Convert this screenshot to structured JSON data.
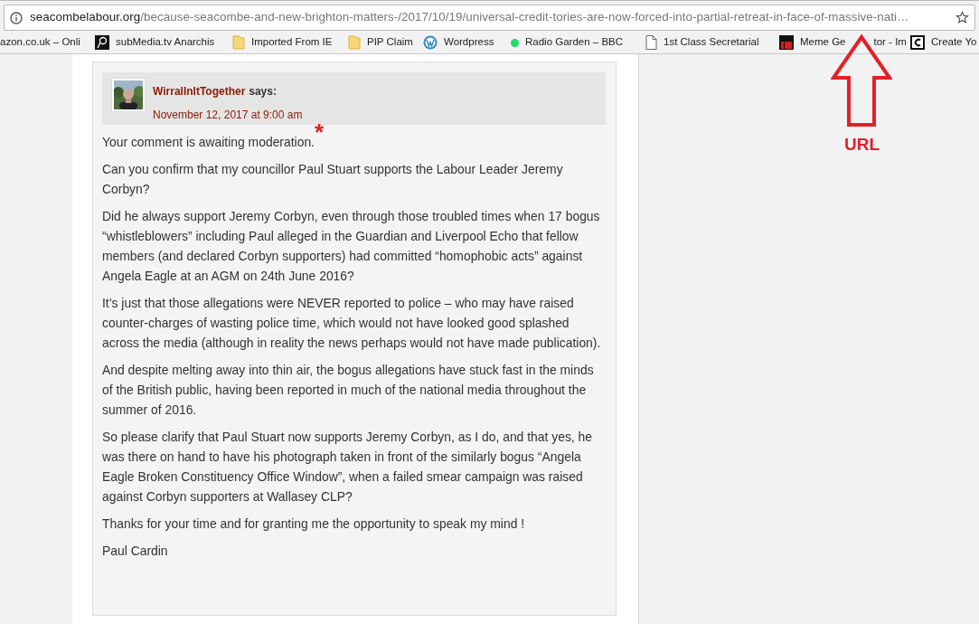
{
  "browser": {
    "url": {
      "domain": "seacombelabour.org",
      "path": "/because-seacombe-and-new-brighton-matters-/2017/10/19/universal-credit-tories-are-now-forced-into-partial-retreat-in-face-of-massive-nati…"
    },
    "bookmarks": [
      {
        "label": "azon.co.uk – Onli",
        "kind": "none"
      },
      {
        "label": "subMedia.tv Anarchis",
        "kind": "dark-square"
      },
      {
        "label": "Imported From IE",
        "kind": "folder"
      },
      {
        "label": "PIP Claim",
        "kind": "folder"
      },
      {
        "label": "Wordpress",
        "kind": "wordpress"
      },
      {
        "label": "Radio Garden – BBC",
        "kind": "dot",
        "color": "#22dd66"
      },
      {
        "label": "1st Class Secretarial",
        "kind": "page"
      },
      {
        "label": "Meme Ge",
        "label_tail": "tor - Im",
        "kind": "red-square"
      },
      {
        "label": "Create Yo",
        "kind": "outlined-square"
      }
    ]
  },
  "comment": {
    "author": "WirralInItTogether",
    "says": "says:",
    "date": "November 12, 2017 at 9:00 am",
    "moderation": "Your comment is awaiting moderation.",
    "paragraphs": [
      "Can you confirm that my councillor Paul Stuart supports the Labour Leader Jeremy Corbyn?",
      "Did he always support Jeremy Corbyn, even through those troubled times when 17 bogus “whistleblowers” including Paul alleged in the Guardian and Liverpool Echo that fellow members (and declared Corbyn supporters) had committed “homophobic acts” against Angela Eagle at an AGM on 24th June 2016?",
      "It’s just that those allegations were NEVER reported to police – who may have raised counter-charges of wasting police time, which would not have looked good splashed across the media (although in reality the news perhaps would not have made publication).",
      "And despite melting away into thin air, the bogus allegations have stuck fast in the minds of the British public, having been reported in much of the national media throughout the summer of 2016.",
      "So please clarify that Paul Stuart now supports Jeremy Corbyn, as I do, and that yes, he was there on hand to have his photograph taken in front of the similarly bogus “Angela Eagle Broken Constituency Office Window”, when a failed smear campaign was raised against Corbyn supporters at Wallasey CLP?",
      "Thanks for your time and for granting me the opportunity to speak my mind !",
      "Paul Cardin"
    ]
  },
  "annotations": {
    "asterisk": "*",
    "arrow_label": "URL"
  }
}
